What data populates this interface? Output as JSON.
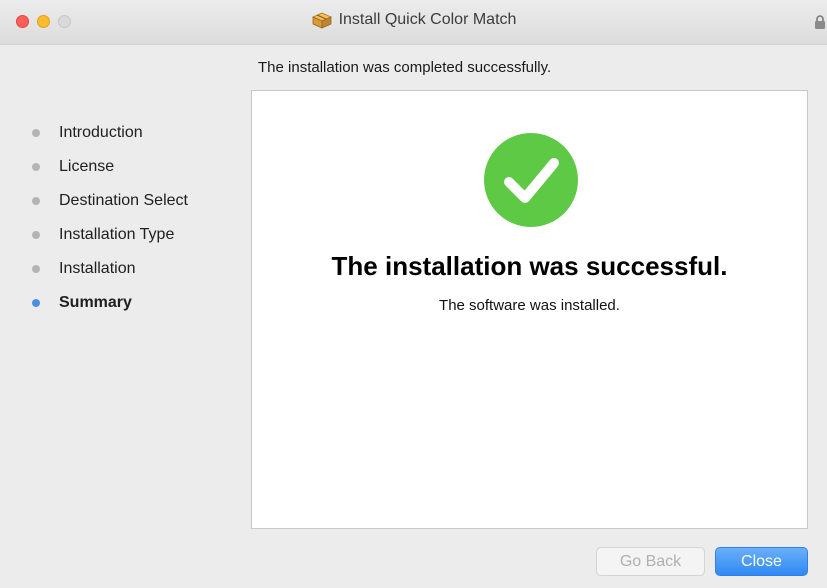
{
  "window": {
    "title": "Install Quick Color Match"
  },
  "header": {
    "subtitle": "The installation was completed successfully."
  },
  "sidebar": {
    "steps": [
      {
        "label": "Introduction",
        "active": false
      },
      {
        "label": "License",
        "active": false
      },
      {
        "label": "Destination Select",
        "active": false
      },
      {
        "label": "Installation Type",
        "active": false
      },
      {
        "label": "Installation",
        "active": false
      },
      {
        "label": "Summary",
        "active": true
      }
    ]
  },
  "main": {
    "title": "The installation was successful.",
    "message": "The software was installed.",
    "status_icon": "checkmark-circle-icon"
  },
  "buttons": {
    "go_back": "Go Back",
    "close": "Close"
  },
  "colors": {
    "accent": "#4a90e2",
    "success": "#5dc944",
    "close_light": "#fc5f57",
    "minimize_light": "#fdbc2e"
  }
}
